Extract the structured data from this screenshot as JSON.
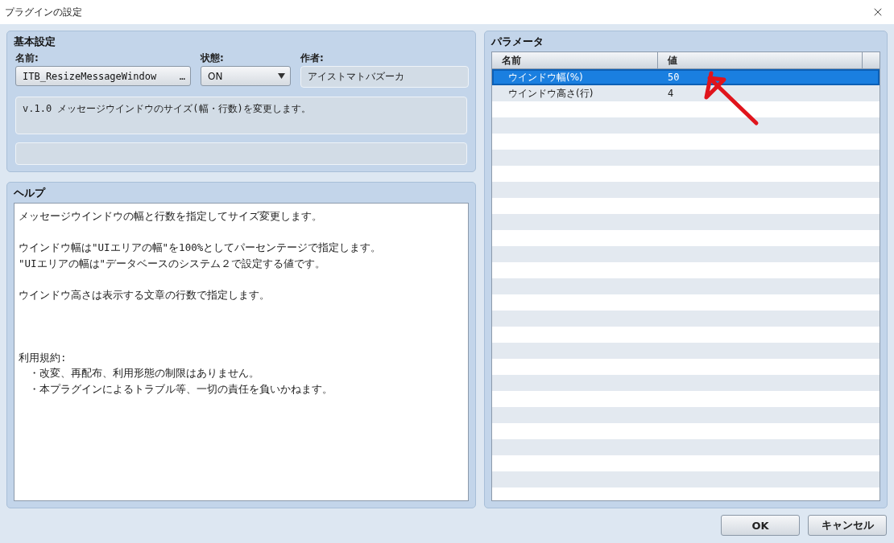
{
  "window": {
    "title": "プラグインの設定"
  },
  "basic_settings": {
    "title": "基本設定",
    "name_label": "名前:",
    "name_value": "ITB_ResizeMessageWindow",
    "name_button": "…",
    "status_label": "状態:",
    "status_value": "ON",
    "author_label": "作者:",
    "author_value": "アイストマトバズーカ",
    "description": "v.1.0 メッセージウインドウのサイズ(幅・行数)を変更します。"
  },
  "help": {
    "title": "ヘルプ",
    "paragraphs": [
      [
        "メッセージウインドウの幅と行数を指定してサイズ変更します。"
      ],
      [
        "ウインドウ幅は\"UIエリアの幅\"を100%としてパーセンテージで指定します。",
        "\"UIエリアの幅は\"データベースのシステム２で設定する値です。"
      ],
      [
        "ウインドウ高さは表示する文章の行数で指定します。"
      ]
    ],
    "terms": {
      "heading": "利用規約:",
      "items": [
        "・改変、再配布、利用形態の制限はありません。",
        "・本プラグインによるトラブル等、一切の責任を負いかねます。"
      ]
    }
  },
  "parameters": {
    "title": "パラメータ",
    "columns": [
      "名前",
      "値"
    ],
    "rows": [
      {
        "name": "ウインドウ幅(%)",
        "value": "50",
        "selected": true
      },
      {
        "name": "ウインドウ高さ(行)",
        "value": "4",
        "selected": false
      }
    ]
  },
  "buttons": [
    {
      "label": "OK"
    },
    {
      "label": "キャンセル"
    }
  ]
}
